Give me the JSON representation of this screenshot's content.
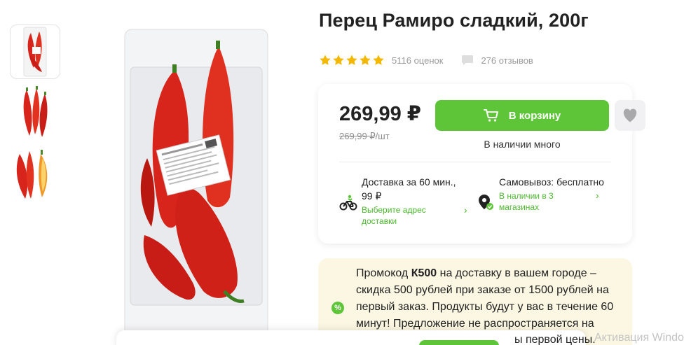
{
  "product": {
    "title": "Перец Рамиро сладкий, 200г",
    "rating": {
      "stars": 5,
      "ratings_count": "5116 оценок",
      "reviews_count": "276 отзывов"
    }
  },
  "buy": {
    "price": "269,99 ₽",
    "unit_price": "269,99 ₽",
    "unit_suffix": "/шт",
    "cart_button_label": "В корзину",
    "stock_status": "В наличии много"
  },
  "delivery": {
    "title": "Доставка за 60 мин.,",
    "price": "99 ₽",
    "link": "Выберите адрес доставки"
  },
  "pickup": {
    "title": "Самовывоз: бесплатно",
    "link": "В наличии в 3 магазинах"
  },
  "promo": {
    "icon_label": "%",
    "prefix": "Промокод ",
    "code": "К500",
    "text": " на доставку в вашем городе – скидка 500 рублей при заказе от 1500 рублей на первый заказ. Продукты будут у вас в течение 60 минут! Предложение не распространяется на",
    "cut_text": "ы первой цены."
  },
  "watermark": "Активация Window",
  "colors": {
    "accent_green": "#5ec539",
    "star_yellow": "#f5b800",
    "promo_bg": "#fbf7e2",
    "pepper_red": "#d8251c"
  },
  "icons": {
    "rating": "star-icon",
    "reviews": "comment-icon",
    "cart": "cart-icon",
    "favorite": "heart-icon",
    "delivery": "bicycle-courier-icon",
    "pickup": "store-pin-icon",
    "promo": "percent-icon"
  }
}
